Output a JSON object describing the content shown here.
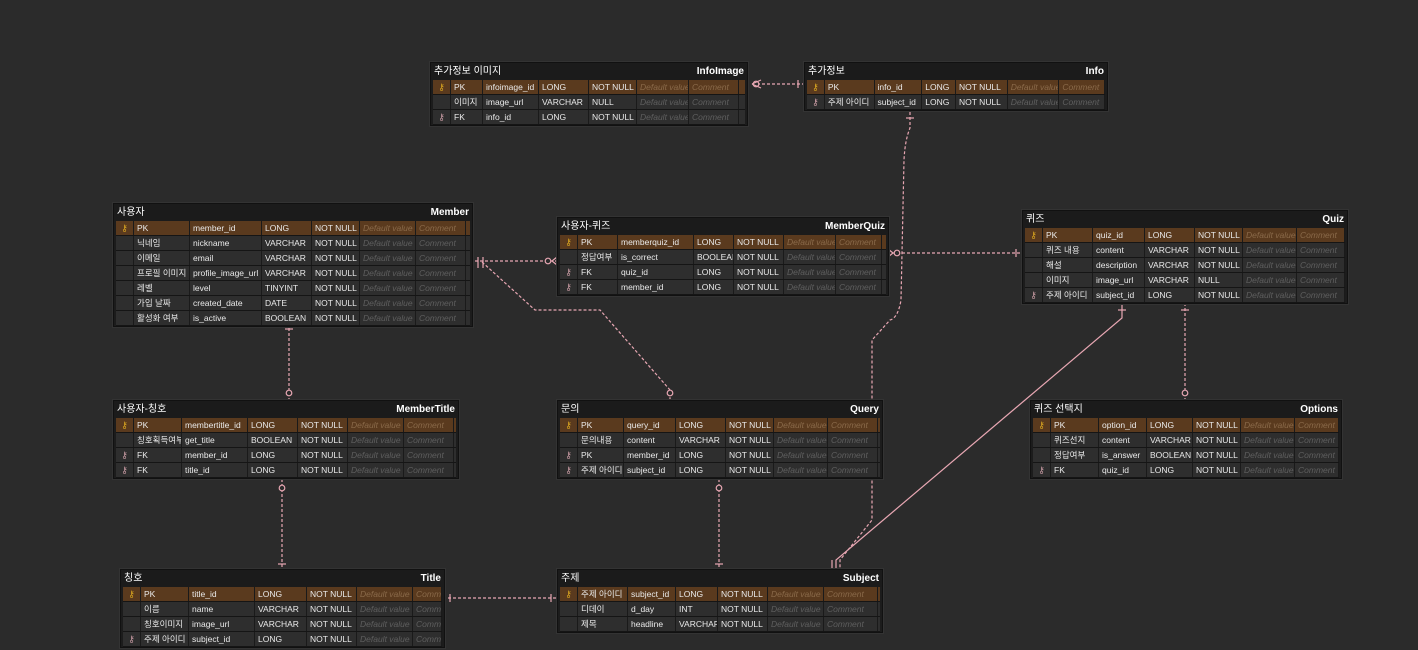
{
  "relationship_color": "#e8a7b3",
  "placeholders": {
    "default": "Default value",
    "comment": "Comment"
  },
  "entities": {
    "infoimage": {
      "logical": "추가정보 이미지",
      "physical": "InfoImage",
      "fields": [
        {
          "key": "PK",
          "name": "infoimage_id",
          "type": "LONG",
          "null": "NOT NULL",
          "icon": "pk"
        },
        {
          "key": "이미지",
          "name": "image_url",
          "type": "VARCHAR",
          "null": "NULL",
          "icon": ""
        },
        {
          "key": "FK",
          "name": "info_id",
          "type": "LONG",
          "null": "NOT NULL",
          "icon": "fk"
        }
      ]
    },
    "info": {
      "logical": "추가정보",
      "physical": "Info",
      "fields": [
        {
          "key": "PK",
          "name": "info_id",
          "type": "LONG",
          "null": "NOT NULL",
          "icon": "pk"
        },
        {
          "key": "주제 아이디",
          "name": "subject_id",
          "type": "LONG",
          "null": "NOT NULL",
          "icon": "fk"
        }
      ]
    },
    "member": {
      "logical": "사용자",
      "physical": "Member",
      "fields": [
        {
          "key": "PK",
          "name": "member_id",
          "type": "LONG",
          "null": "NOT NULL",
          "icon": "pk"
        },
        {
          "key": "닉네임",
          "name": "nickname",
          "type": "VARCHAR",
          "null": "NOT NULL",
          "icon": ""
        },
        {
          "key": "이메일",
          "name": "email",
          "type": "VARCHAR",
          "null": "NOT NULL",
          "icon": ""
        },
        {
          "key": "프로필 이미지",
          "name": "profile_image_url",
          "type": "VARCHAR",
          "null": "NOT NULL",
          "icon": ""
        },
        {
          "key": "레벨",
          "name": "level",
          "type": "TINYINT",
          "null": "NOT NULL",
          "icon": ""
        },
        {
          "key": "가입 날짜",
          "name": "created_date",
          "type": "DATE",
          "null": "NOT NULL",
          "icon": ""
        },
        {
          "key": "활성화 여부",
          "name": "is_active",
          "type": "BOOLEAN",
          "null": "NOT NULL",
          "icon": ""
        }
      ]
    },
    "memberquiz": {
      "logical": "사용자-퀴즈",
      "physical": "MemberQuiz",
      "fields": [
        {
          "key": "PK",
          "name": "memberquiz_id",
          "type": "LONG",
          "null": "NOT NULL",
          "icon": "pk"
        },
        {
          "key": "정답여부",
          "name": "is_correct",
          "type": "BOOLEAN",
          "null": "NOT NULL",
          "icon": ""
        },
        {
          "key": "FK",
          "name": "quiz_id",
          "type": "LONG",
          "null": "NOT NULL",
          "icon": "fk"
        },
        {
          "key": "FK",
          "name": "member_id",
          "type": "LONG",
          "null": "NOT NULL",
          "icon": "fk"
        }
      ]
    },
    "quiz": {
      "logical": "퀴즈",
      "physical": "Quiz",
      "fields": [
        {
          "key": "PK",
          "name": "quiz_id",
          "type": "LONG",
          "null": "NOT NULL",
          "icon": "pk"
        },
        {
          "key": "퀴즈 내용",
          "name": "content",
          "type": "VARCHAR",
          "null": "NOT NULL",
          "icon": ""
        },
        {
          "key": "해설",
          "name": "description",
          "type": "VARCHAR",
          "null": "NOT NULL",
          "icon": ""
        },
        {
          "key": "이미지",
          "name": "image_url",
          "type": "VARCHAR",
          "null": "NULL",
          "icon": ""
        },
        {
          "key": "주제 아이디",
          "name": "subject_id",
          "type": "LONG",
          "null": "NOT NULL",
          "icon": "fk"
        }
      ]
    },
    "membertitle": {
      "logical": "사용자-칭호",
      "physical": "MemberTitle",
      "fields": [
        {
          "key": "PK",
          "name": "membertitle_id",
          "type": "LONG",
          "null": "NOT NULL",
          "icon": "pk"
        },
        {
          "key": "칭호획득여부",
          "name": "get_title",
          "type": "BOOLEAN",
          "null": "NOT NULL",
          "icon": ""
        },
        {
          "key": "FK",
          "name": "member_id",
          "type": "LONG",
          "null": "NOT NULL",
          "icon": "fk"
        },
        {
          "key": "FK",
          "name": "title_id",
          "type": "LONG",
          "null": "NOT NULL",
          "icon": "fk"
        }
      ]
    },
    "query": {
      "logical": "문의",
      "physical": "Query",
      "fields": [
        {
          "key": "PK",
          "name": "query_id",
          "type": "LONG",
          "null": "NOT NULL",
          "icon": "pk"
        },
        {
          "key": "문의내용",
          "name": "content",
          "type": "VARCHAR",
          "null": "NOT NULL",
          "icon": ""
        },
        {
          "key": "PK",
          "name": "member_id",
          "type": "LONG",
          "null": "NOT NULL",
          "icon": "fk"
        },
        {
          "key": "주제 아이디",
          "name": "subject_id",
          "type": "LONG",
          "null": "NOT NULL",
          "icon": "fk"
        }
      ]
    },
    "options": {
      "logical": "퀴즈 선택지",
      "physical": "Options",
      "fields": [
        {
          "key": "PK",
          "name": "option_id",
          "type": "LONG",
          "null": "NOT NULL",
          "icon": "pk"
        },
        {
          "key": "퀴즈선지",
          "name": "content",
          "type": "VARCHAR",
          "null": "NOT NULL",
          "icon": ""
        },
        {
          "key": "정답여부",
          "name": "is_answer",
          "type": "BOOLEAN",
          "null": "NOT NULL",
          "icon": ""
        },
        {
          "key": "FK",
          "name": "quiz_id",
          "type": "LONG",
          "null": "NOT NULL",
          "icon": "fk"
        }
      ]
    },
    "title": {
      "logical": "칭호",
      "physical": "Title",
      "fields": [
        {
          "key": "PK",
          "name": "title_id",
          "type": "LONG",
          "null": "NOT NULL",
          "icon": "pk"
        },
        {
          "key": "이름",
          "name": "name",
          "type": "VARCHAR",
          "null": "NOT NULL",
          "icon": ""
        },
        {
          "key": "칭호이미지",
          "name": "image_url",
          "type": "VARCHAR",
          "null": "NOT NULL",
          "icon": ""
        },
        {
          "key": "주제 아이디",
          "name": "subject_id",
          "type": "LONG",
          "null": "NOT NULL",
          "icon": "fk"
        }
      ]
    },
    "subject": {
      "logical": "주제",
      "physical": "Subject",
      "fields": [
        {
          "key": "주제 아이디",
          "name": "subject_id",
          "type": "LONG",
          "null": "NOT NULL",
          "icon": "pk"
        },
        {
          "key": "디데이",
          "name": "d_day",
          "type": "INT",
          "null": "NOT NULL",
          "icon": ""
        },
        {
          "key": "제목",
          "name": "headline",
          "type": "VARCHAR",
          "null": "NOT NULL",
          "icon": ""
        }
      ]
    }
  }
}
